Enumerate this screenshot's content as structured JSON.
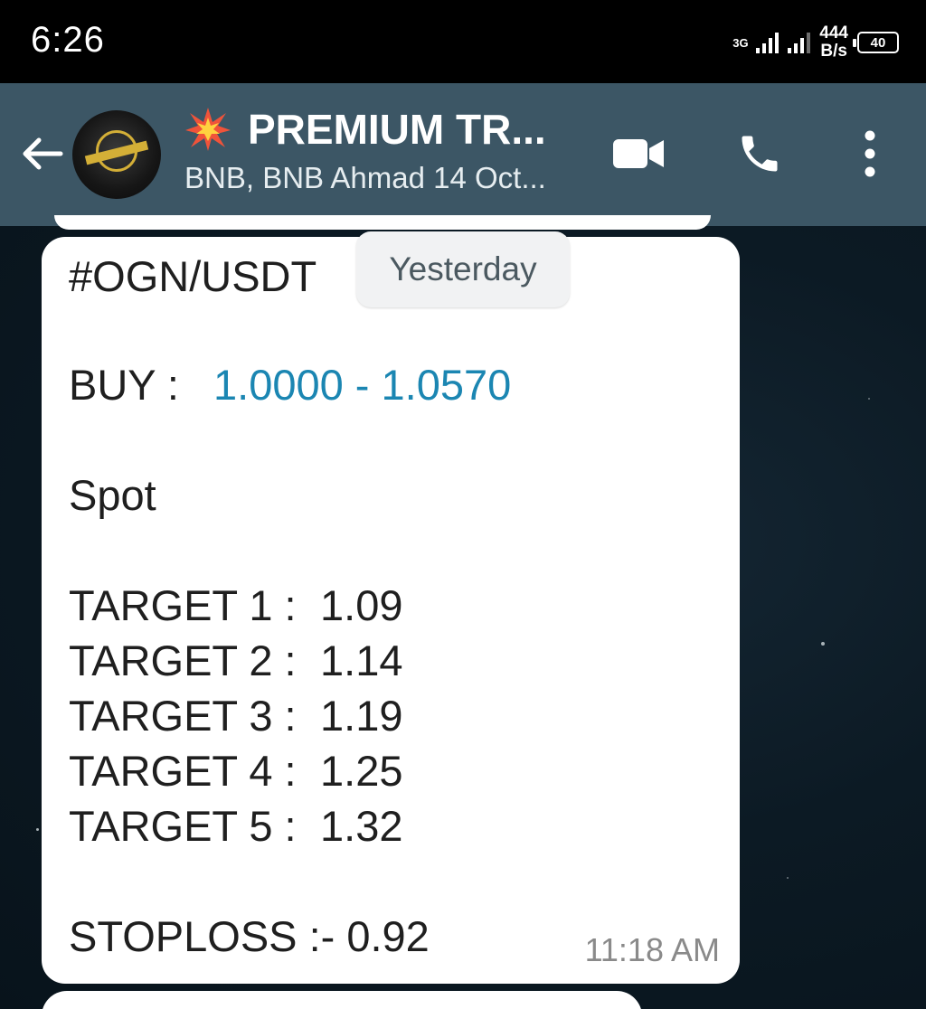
{
  "status_bar": {
    "time": "6:26",
    "network_type": "3G",
    "speed_value": "444",
    "speed_unit": "B/s",
    "battery": "40"
  },
  "header": {
    "title": "PREMIUM TR...",
    "subtitle": "BNB, BNB Ahmad 14 Oct...",
    "title_icon": "collision-burst-icon",
    "actions": [
      "video-call-icon",
      "voice-call-icon",
      "more-options-icon"
    ]
  },
  "date_chip": "Yesterday",
  "message": {
    "pair": "#OGN/USDT",
    "buy_label": "BUY  :",
    "buy_range": "1.0000 - 1.0570",
    "market": "Spot",
    "targets": [
      {
        "label": "TARGET 1 :",
        "value": "1.09"
      },
      {
        "label": "TARGET 2 :",
        "value": "1.14"
      },
      {
        "label": "TARGET 3 :",
        "value": "1.19"
      },
      {
        "label": "TARGET 4 :",
        "value": "1.25"
      },
      {
        "label": "TARGET 5 :",
        "value": "1.32"
      }
    ],
    "stoploss": "STOPLOSS :- 0.92",
    "time": "11:18 AM"
  },
  "colors": {
    "header_bg": "#3c5665",
    "link": "#1b86b2",
    "bubble": "#ffffff",
    "wallpaper": "#0c1a24"
  }
}
